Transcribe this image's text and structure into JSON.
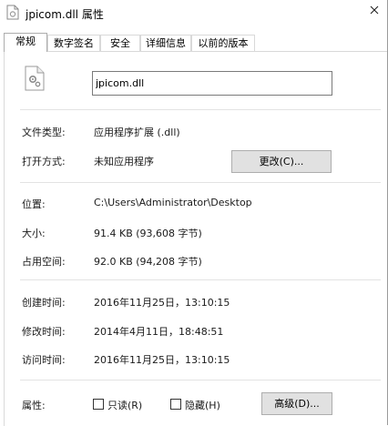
{
  "window": {
    "title": "jpicom.dll 属性",
    "title_icon": "file-properties-icon",
    "close_icon": "close-icon"
  },
  "tabs": [
    {
      "label": "常规",
      "active": true
    },
    {
      "label": "数字签名",
      "active": false
    },
    {
      "label": "安全",
      "active": false
    },
    {
      "label": "详细信息",
      "active": false
    },
    {
      "label": "以前的版本",
      "active": false
    }
  ],
  "file": {
    "icon": "dll-file-gear-icon",
    "name": "jpicom.dll"
  },
  "fields": {
    "file_type_label": "文件类型:",
    "file_type_value": "应用程序扩展 (.dll)",
    "open_with_label": "打开方式:",
    "open_with_value": "未知应用程序",
    "change_button": "更改(C)...",
    "location_label": "位置:",
    "location_value": "C:\\Users\\Administrator\\Desktop",
    "size_label": "大小:",
    "size_value": "91.4 KB (93,608 字节)",
    "disk_size_label": "占用空间:",
    "disk_size_value": "92.0 KB (94,208 字节)",
    "created_label": "创建时间:",
    "created_value": "2016年11月25日，13:10:15",
    "modified_label": "修改时间:",
    "modified_value": "2014年4月11日，18:48:51",
    "accessed_label": "访问时间:",
    "accessed_value": "2016年11月25日，13:10:15",
    "attributes_label": "属性:",
    "readonly_label": "只读(R)",
    "readonly_checked": false,
    "hidden_label": "隐藏(H)",
    "hidden_checked": false,
    "advanced_button": "高级(D)..."
  },
  "colors": {
    "button_face": "#e1e1e1",
    "border": "#adadad",
    "separator": "#e3e3e3"
  }
}
